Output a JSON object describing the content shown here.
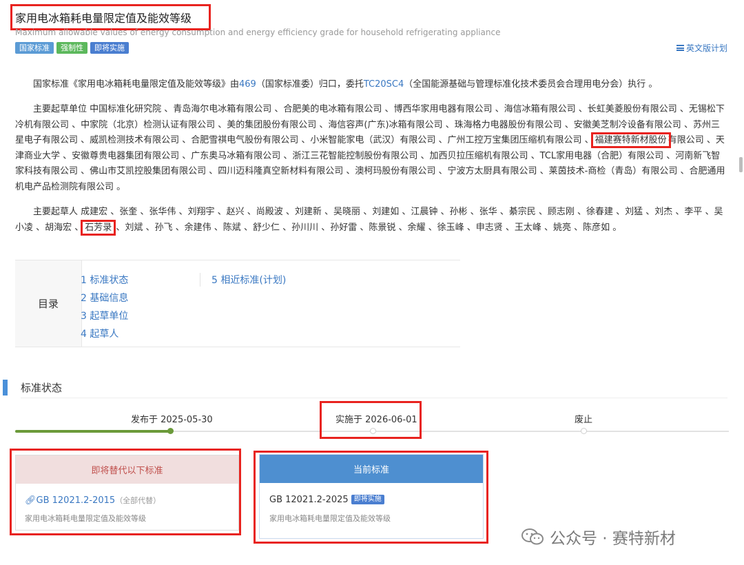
{
  "header": {
    "title": "家用电冰箱耗电量限定值及能效等级",
    "subtitle": "Maximum allowable values of energy consumption and energy efficiency grade for household refrigerating appliance",
    "badges": [
      "国家标准",
      "强制性",
      "即将实施"
    ],
    "english_plan": "英文版计划"
  },
  "intro": {
    "prefix": "国家标准《家用电冰箱耗电量限定值及能效等级》由",
    "tc_number": "469",
    "middle": "（国家标准委）归口，委托",
    "sub_tc": "TC20SC4",
    "suffix": "（全国能源基础与管理标准化技术委员会合理用电分会）执行 。"
  },
  "drafting_units": {
    "lead": "主要起草单位 中国标准化研究院 、青岛海尔电冰箱有限公司 、合肥美的电冰箱有限公司 、博西华家用电器有限公司 、海信冰箱有限公司 、长虹美菱股份有限公司 、无锡松下冷机有限公司 、中家院（北京）检测认证有限公司 、美的集团股份有限公司 、海信容声(广东)冰箱有限公司 、珠海格力电器股份有限公司 、安徽美芝制冷设备有限公司 、苏州三星电子有限公司 、威凯检测技术有限公司 、合肥雪祺电气股份有限公司 、小米智能家电（武汉）有限公司 、广州工控万宝集团压缩机有限公司 、",
    "highlighted": "福建赛特新材股份",
    "rest": "有限公司 、天津商业大学 、安徽尊贵电器集团有限公司 、广东奥马冰箱有限公司 、浙江三花智能控制股份有限公司 、加西贝拉压缩机有限公司 、TCL家用电器（合肥）有限公司 、河南新飞智家科技有限公司 、佛山市艾凯控股集团有限公司 、四川迈科隆真空新材料有限公司 、澳柯玛股份有限公司 、宁波方太厨具有限公司 、莱茵技术-商检（青岛）有限公司 、合肥通用机电产品检测院有限公司 。"
  },
  "drafters": {
    "lead": "主要起草人 成建宏 、张奎 、张华伟 、刘翔宇 、赵兴 、尚殿波 、刘建新 、吴晓丽 、刘建如 、江晨钟 、孙彬 、张华 、綦宗民 、顾志刚 、徐春建 、刘猛 、刘杰 、李平 、吴小凌 、胡海宏 、",
    "highlighted": "石芳录",
    "rest": " 、刘斌 、孙飞 、余建伟 、陈斌 、舒少仁 、孙川川 、孙好雷 、陈景锐 、余耀 、徐玉峰 、申志贤 、王太峰 、姚亮 、陈彦如 。"
  },
  "toc": {
    "label": "目录",
    "items": [
      "1 标准状态",
      "2 基础信息",
      "3 起草单位",
      "4 起草人",
      "5 相近标准(计划)"
    ]
  },
  "status_section": {
    "title": "标准状态",
    "timeline": [
      {
        "label": "发布于 2025-05-30",
        "state": "done"
      },
      {
        "label": "实施于 2026-06-01",
        "state": "pending"
      },
      {
        "label": "废止",
        "state": "pending"
      }
    ],
    "replace_card": {
      "header": "即将替代以下标准",
      "code": "GB 12021.2-2015",
      "note": "（全部代替）",
      "desc": "家用电冰箱耗电量限定值及能效等级"
    },
    "current_card": {
      "header": "当前标准",
      "code": "GB 12021.2-2025",
      "chip": "即将实施",
      "desc": "家用电冰箱耗电量限定值及能效等级"
    }
  },
  "watermark": "公众号 · 赛特新材",
  "colors": {
    "accent": "#3a78c2",
    "highlight": "#e8231f",
    "done": "#6b9a3a",
    "current_head": "#4e8fd0",
    "replace_head": "#f1dede"
  }
}
